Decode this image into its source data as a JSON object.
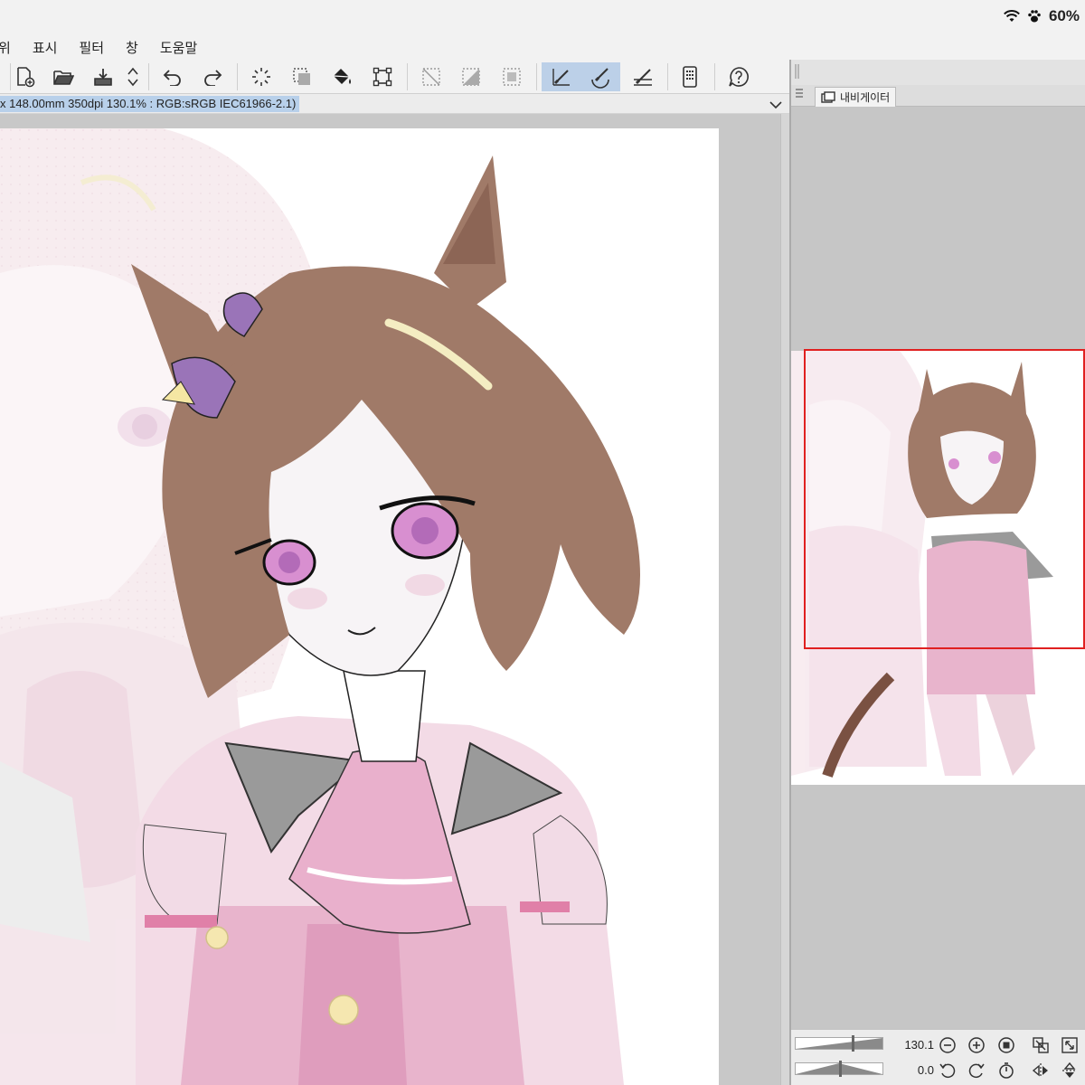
{
  "status_bar": {
    "battery_percent": "60%",
    "icons": [
      "wifi-icon",
      "paw-icon"
    ]
  },
  "menu": {
    "items": [
      "위",
      "표시",
      "필터",
      "창",
      "도움말"
    ]
  },
  "toolbar": {
    "buttons": [
      "new-file-icon",
      "open-folder-icon",
      "save-icon",
      "scroll-arrows-icon",
      "undo-icon",
      "redo-icon",
      "deselect-icon",
      "select-icon",
      "fill-icon",
      "transform-icon",
      "hide-selection-icon",
      "clear-icon",
      "fill-selection-icon",
      "ruler-snap-icon",
      "brush-snap-icon",
      "perspective-snap-icon",
      "smartphone-icon",
      "help-icon"
    ],
    "active": [
      "ruler-snap-icon",
      "brush-snap-icon"
    ]
  },
  "info_bar": {
    "text": "x 148.00mm 350dpi 130.1% : RGB:sRGB IEC61966-2.1)"
  },
  "navigator": {
    "tab_label": "내비게이터",
    "zoom_value": "130.1",
    "rotation_value": "0.0"
  },
  "colors": {
    "viewport_frame": "#e02020",
    "active_tool_bg": "#bcd0e8",
    "info_highlight": "#b8d0ea",
    "hair": "#a07a68",
    "outfit_pink": "#e8b4cc"
  }
}
